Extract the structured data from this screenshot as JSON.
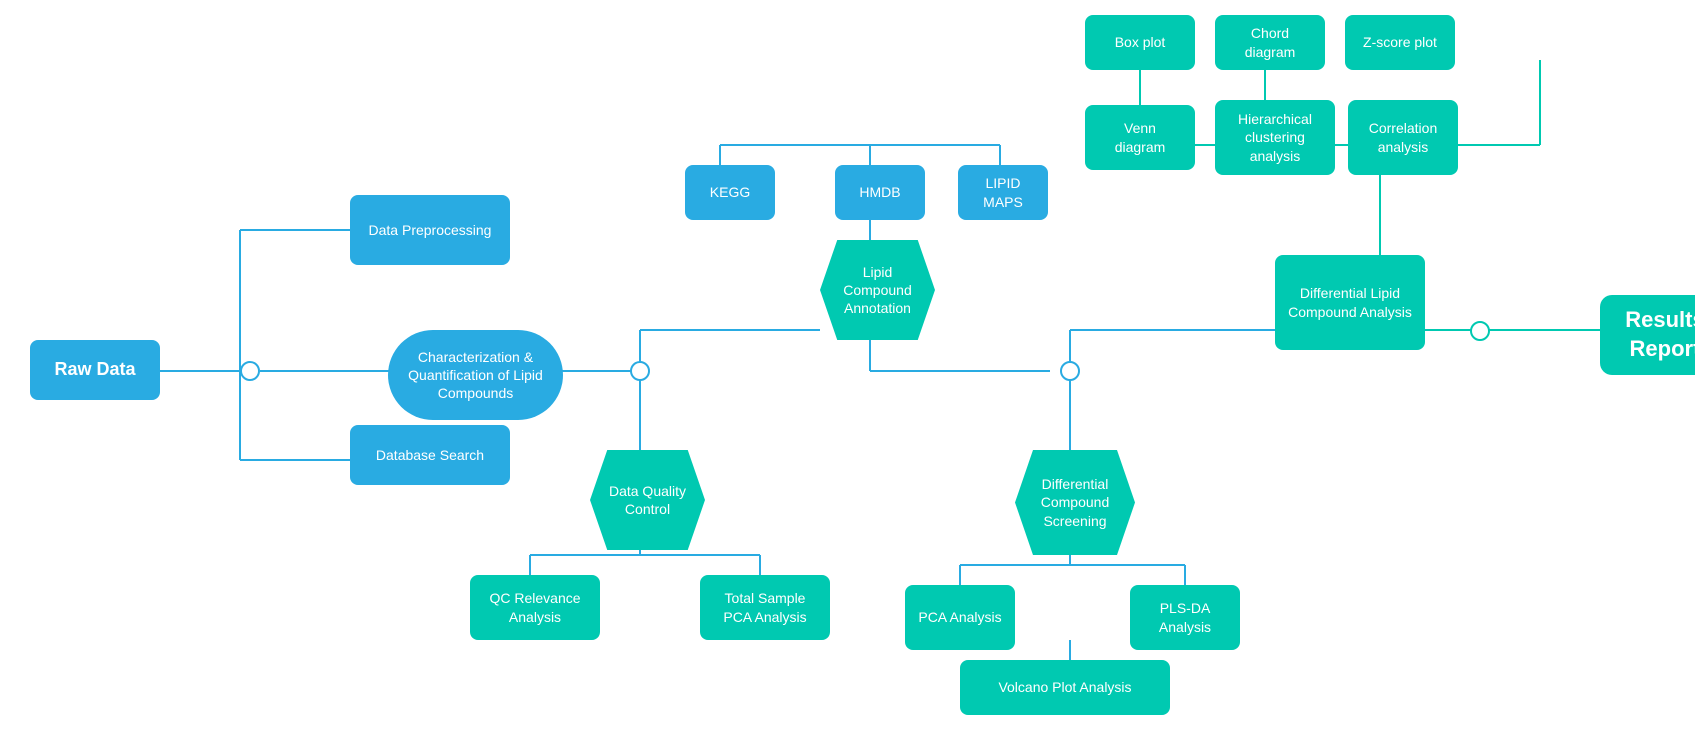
{
  "nodes": {
    "raw_data": {
      "label": "Raw Data"
    },
    "data_preprocessing": {
      "label": "Data\nPreprocessing"
    },
    "database_search": {
      "label": "Database Search"
    },
    "characterization": {
      "label": "Characterization &\nQuantification of\nLipid Compounds"
    },
    "kegg": {
      "label": "KEGG"
    },
    "hmdb": {
      "label": "HMDB"
    },
    "lipid_maps": {
      "label": "LIPID\nMAPS"
    },
    "lipid_compound_annotation": {
      "label": "Lipid\nCompound\nAnnotation"
    },
    "data_quality_control": {
      "label": "Data Quality\nControl"
    },
    "qc_relevance": {
      "label": "QC Relevance\nAnalysis"
    },
    "total_sample_pca": {
      "label": "Total Sample\nPCA Analysis"
    },
    "differential_compound_screening": {
      "label": "Differential\nCompound\nScreening"
    },
    "pca_analysis": {
      "label": "PCA\nAnalysis"
    },
    "pls_da": {
      "label": "PLS-DA\nAnalysis"
    },
    "volcano_plot": {
      "label": "Volcano Plot Analysis"
    },
    "box_plot": {
      "label": "Box plot"
    },
    "chord_diagram": {
      "label": "Chord\ndiagram"
    },
    "zscore_plot": {
      "label": "Z-score\nplot"
    },
    "venn_diagram": {
      "label": "Venn\ndiagram"
    },
    "hierarchical_clustering": {
      "label": "Hierarchical\nclustering\nanalysis"
    },
    "correlation_analysis": {
      "label": "Correlation\nanalysis"
    },
    "differential_lipid": {
      "label": "Differential Lipid\nCompound\nAnalysis"
    },
    "results_report": {
      "label": "Results\nReport"
    }
  }
}
